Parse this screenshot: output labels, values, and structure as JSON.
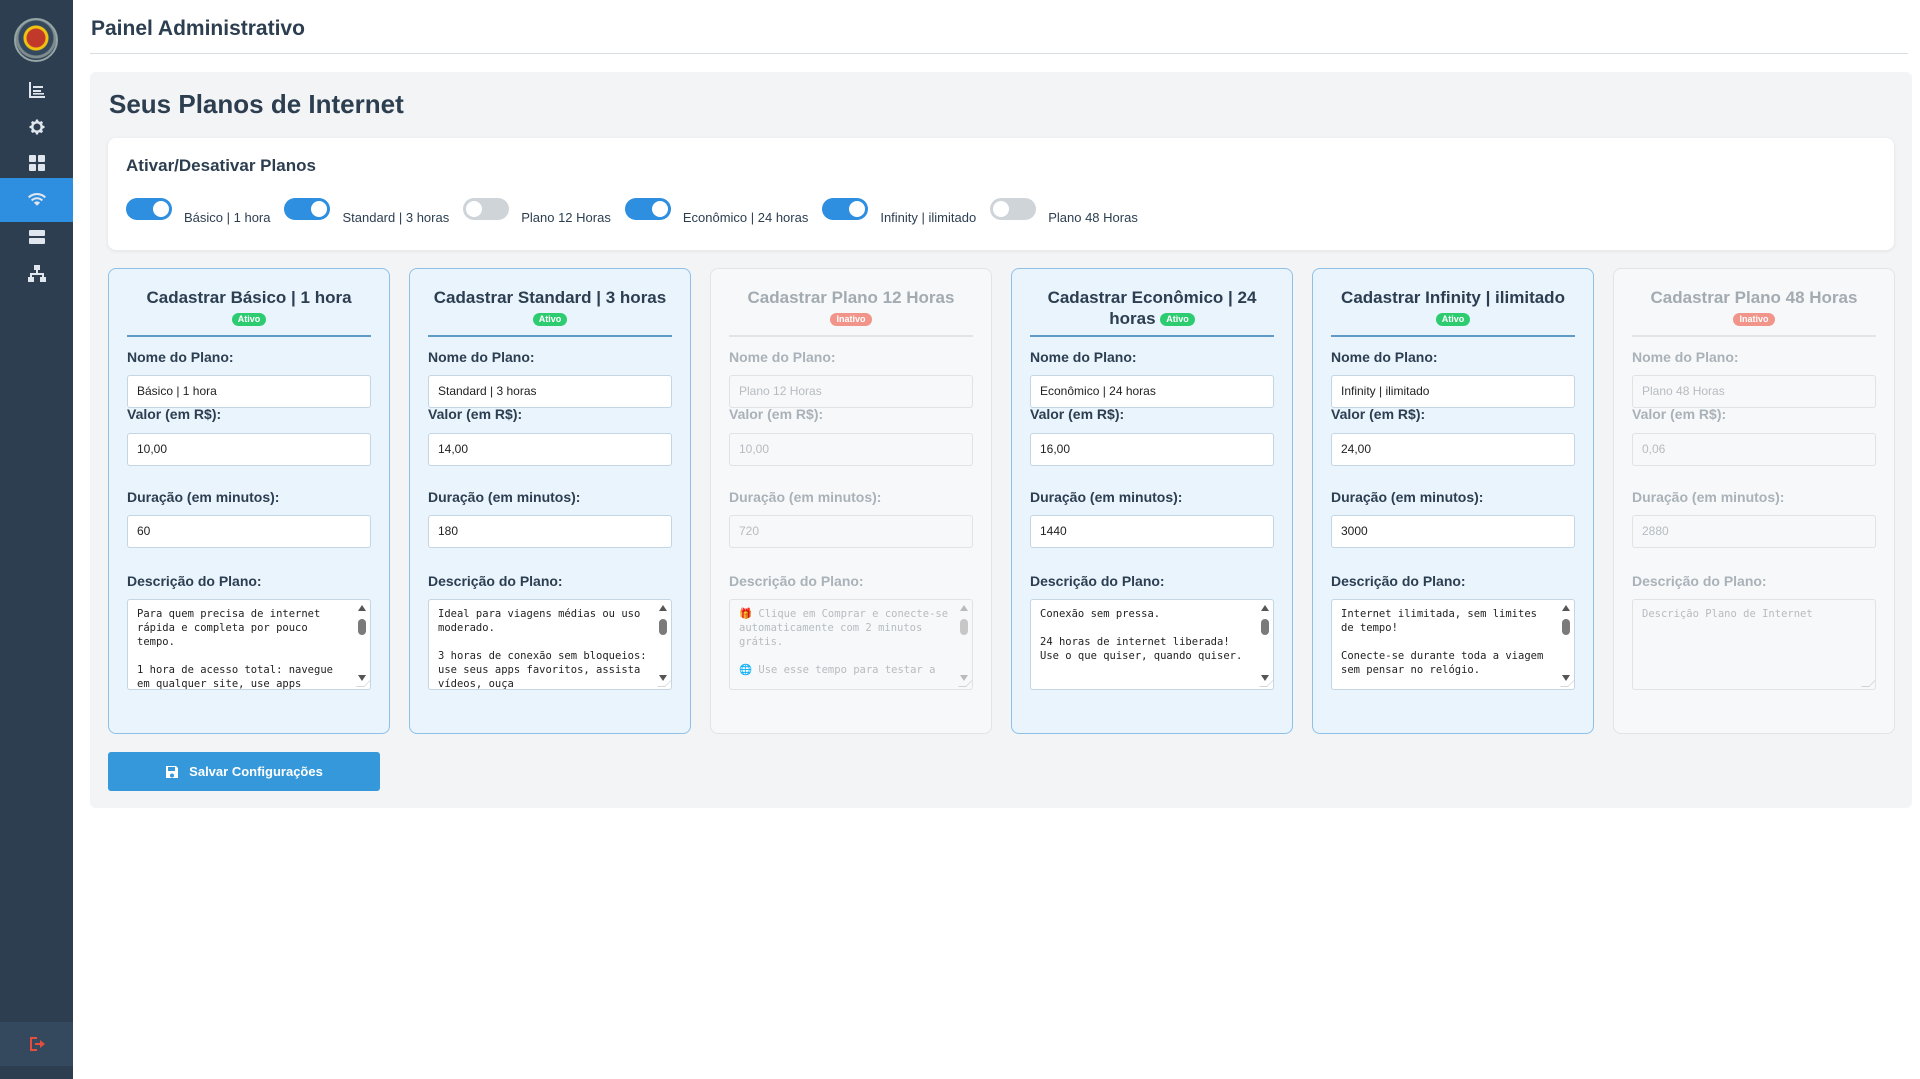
{
  "header": {
    "title": "Painel Administrativo"
  },
  "sidebar": {
    "items": [
      {
        "icon": "chart-icon"
      },
      {
        "icon": "gear-icon"
      },
      {
        "icon": "grid-icon"
      },
      {
        "icon": "wifi-icon",
        "active": true
      },
      {
        "icon": "server-icon"
      },
      {
        "icon": "network-icon"
      }
    ],
    "logout_icon": "logout-icon"
  },
  "page": {
    "title": "Seus Planos de Internet"
  },
  "toggles": {
    "title": "Ativar/Desativar Planos",
    "items": [
      {
        "label": "Básico | 1 hora",
        "on": true
      },
      {
        "label": "Standard | 3 horas",
        "on": true
      },
      {
        "label": "Plano 12 Horas",
        "on": false
      },
      {
        "label": "Econômico | 24 horas",
        "on": true
      },
      {
        "label": "Infinity | ilimitado",
        "on": true
      },
      {
        "label": "Plano 48 Horas",
        "on": false
      }
    ]
  },
  "labels": {
    "name": "Nome do Plano:",
    "price": "Valor (em R$):",
    "duration": "Duração (em minutos):",
    "description": "Descrição do Plano:"
  },
  "cards": [
    {
      "title": "Cadastrar Básico | 1 hora",
      "status": "Ativo",
      "name": "Básico | 1 hora",
      "price": "10,00",
      "duration": "60",
      "description": "Para quem precisa de internet rápida e completa por pouco tempo.\n\n1 hora de acesso total: navegue em qualquer site, use apps"
    },
    {
      "title": "Cadastrar Standard | 3 horas",
      "status": "Ativo",
      "name": "Standard | 3 horas",
      "price": "14,00",
      "duration": "180",
      "description": "Ideal para viagens médias ou uso moderado.\n\n3 horas de conexão sem bloqueios: use seus apps favoritos, assista vídeos, ouça"
    },
    {
      "title": "Cadastrar Plano 12 Horas",
      "status": "Inativo",
      "name": "Plano 12 Horas",
      "price": "10,00",
      "duration": "720",
      "description": "🎁 Clique em Comprar e conecte-se automaticamente com 2 minutos grátis.\n\n🌐 Use esse tempo para testar a"
    },
    {
      "title": "Cadastrar Econômico | 24 horas",
      "status": "Ativo",
      "name": "Econômico | 24 horas",
      "price": "16,00",
      "duration": "1440",
      "description": "Conexão sem pressa.\n\n24 horas de internet liberada! Use o que quiser, quando quiser."
    },
    {
      "title": "Cadastrar Infinity | ilimitado",
      "status": "Ativo",
      "name": "Infinity | ilimitado",
      "price": "24,00",
      "duration": "3000",
      "description": "Internet ilimitada, sem limites de tempo!\n\nConecte-se durante toda a viagem sem pensar no relógio."
    },
    {
      "title": "Cadastrar Plano 48 Horas",
      "status": "Inativo",
      "name": "Plano 48 Horas",
      "price": "0,06",
      "duration": "2880",
      "description": "",
      "description_placeholder": "Descrição Plano de Internet"
    }
  ],
  "save_button": {
    "label": "Salvar Configurações",
    "icon": "floppy-disk-icon"
  },
  "colors": {
    "sidebar": "#2c3e50",
    "accent": "#2e8ee0",
    "active_badge": "#2ecc71",
    "inactive_badge": "#f1948a"
  }
}
